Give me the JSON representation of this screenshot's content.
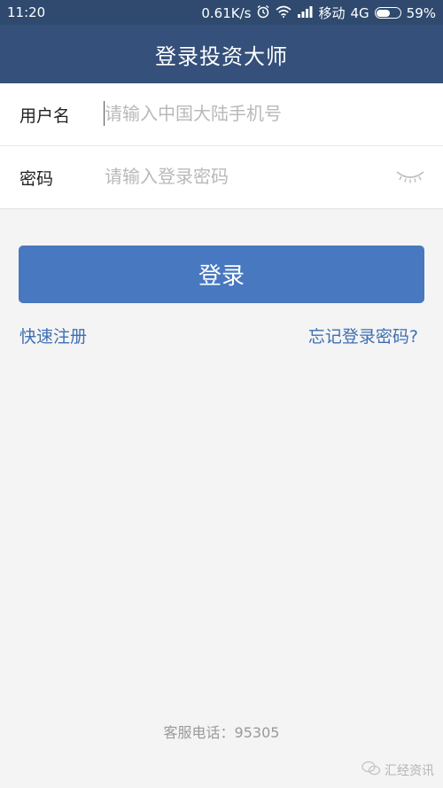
{
  "status_bar": {
    "time": "11:20",
    "network_speed": "0.61K/s",
    "carrier": "移动",
    "network_type": "4G",
    "battery": "59%",
    "battery_level": 0.59,
    "icons": [
      "alarm-icon",
      "wifi-icon",
      "signal-icon",
      "battery-icon"
    ]
  },
  "header": {
    "title": "登录投资大师"
  },
  "form": {
    "username_label": "用户名",
    "username_placeholder": "请输入中国大陆手机号",
    "username_value": "",
    "password_label": "密码",
    "password_placeholder": "请输入登录密码",
    "password_value": "",
    "toggle_icon": "eye-closed-icon"
  },
  "actions": {
    "login_label": "登录",
    "register_label": "快速注册",
    "forgot_label": "忘记登录密码?"
  },
  "footer": {
    "service_phone": "客服电话：95305",
    "watermark": "汇经资讯"
  },
  "colors": {
    "header_bg": "#35507a",
    "status_bg": "#2f4a6e",
    "primary_button": "#4778c0",
    "link": "#3e6fb3",
    "background": "#f4f4f4"
  }
}
